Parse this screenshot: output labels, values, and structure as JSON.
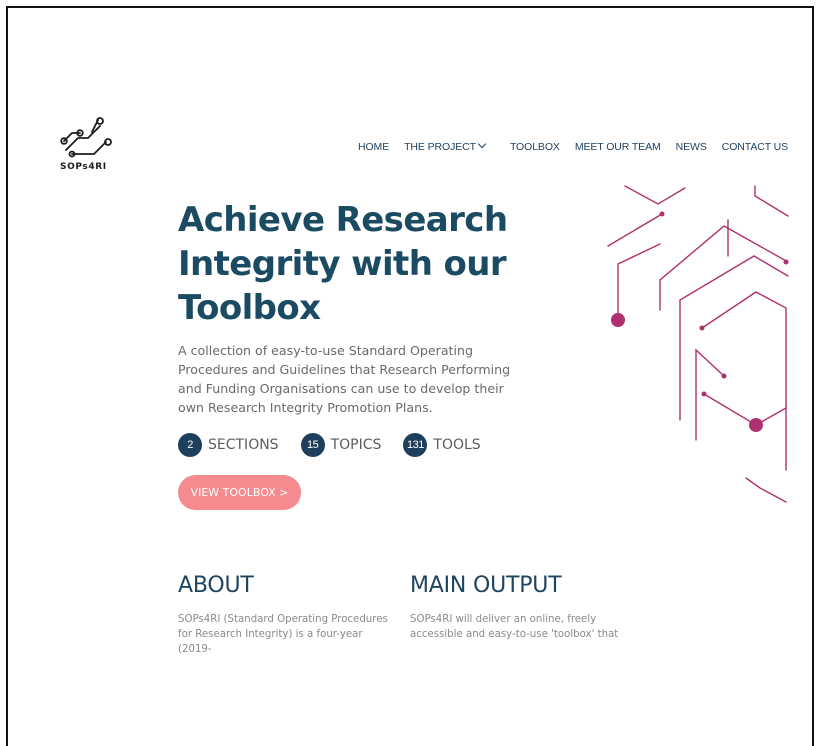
{
  "logo": {
    "text": "SOPs4RI",
    "icon": "circuit-logo-icon"
  },
  "nav": {
    "items": [
      {
        "label": "HOME"
      },
      {
        "label": "THE PROJECT",
        "has_dropdown": true
      },
      {
        "label": "TOOLBOX"
      },
      {
        "label": "MEET OUR TEAM"
      },
      {
        "label": "NEWS"
      },
      {
        "label": "CONTACT US"
      }
    ]
  },
  "hero": {
    "title_lines": [
      "Achieve Research",
      "Integrity with our",
      "Toolbox"
    ],
    "description": "A collection of easy-to-use Standard Operating Procedures and Guidelines that Research Performing and Funding Organisations can use to develop their own Research Integrity Promotion Plans.",
    "stats": [
      {
        "count": "2",
        "label": "SECTIONS"
      },
      {
        "count": "15",
        "label": "TOPICS"
      },
      {
        "count": "131",
        "label": "TOOLS"
      }
    ],
    "cta_label": "VIEW TOOLBOX >"
  },
  "sections": {
    "about": {
      "title": "ABOUT",
      "body": "SOPs4RI (Standard Operating Procedures for Research Integrity) is a four-year (2019-"
    },
    "main_output": {
      "title": "MAIN OUTPUT",
      "body": "SOPs4RI will deliver an online, freely accessible and easy-to-use 'toolbox' that"
    }
  },
  "colors": {
    "navy": "#1b4a63",
    "badge": "#1d3f5b",
    "cta": "#f58a8f",
    "circuit": "#b0306f"
  }
}
